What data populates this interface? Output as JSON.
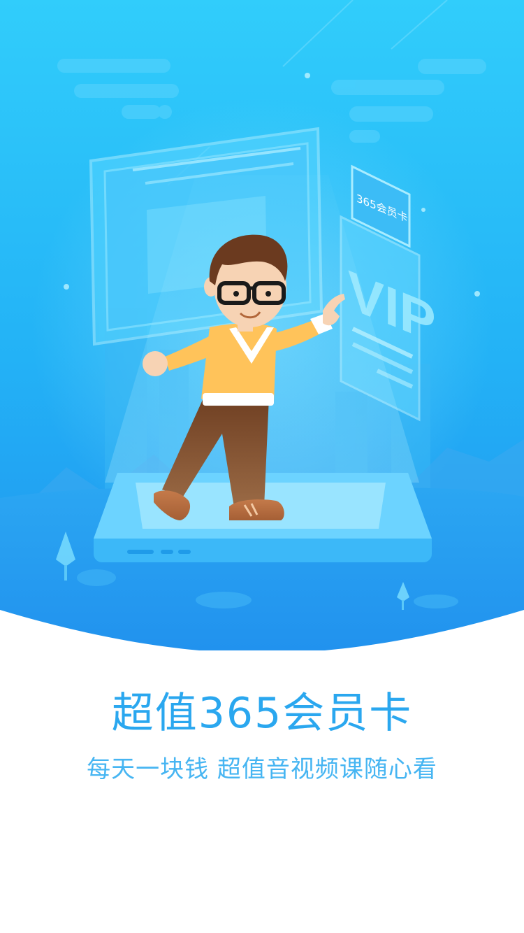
{
  "splash": {
    "title": "超值365会员卡",
    "subtitle": "每天一块钱 超值音视频课随心看"
  },
  "illustration": {
    "card_tag_text": "365会员卡",
    "card_logo_text": "VIP"
  },
  "colors": {
    "sky_top": "#31cdfb",
    "sky_bottom": "#2192ee",
    "title": "#2aa7ef",
    "subtitle": "#46b5f2",
    "platform": "#6cd3ff",
    "sweater": "#ffc35a",
    "trousers": "#7a4a2b",
    "hair": "#6b3a1f"
  },
  "icons": [
    "vip-card-icon",
    "person-illustration",
    "tree-icon",
    "cloud-icon"
  ]
}
